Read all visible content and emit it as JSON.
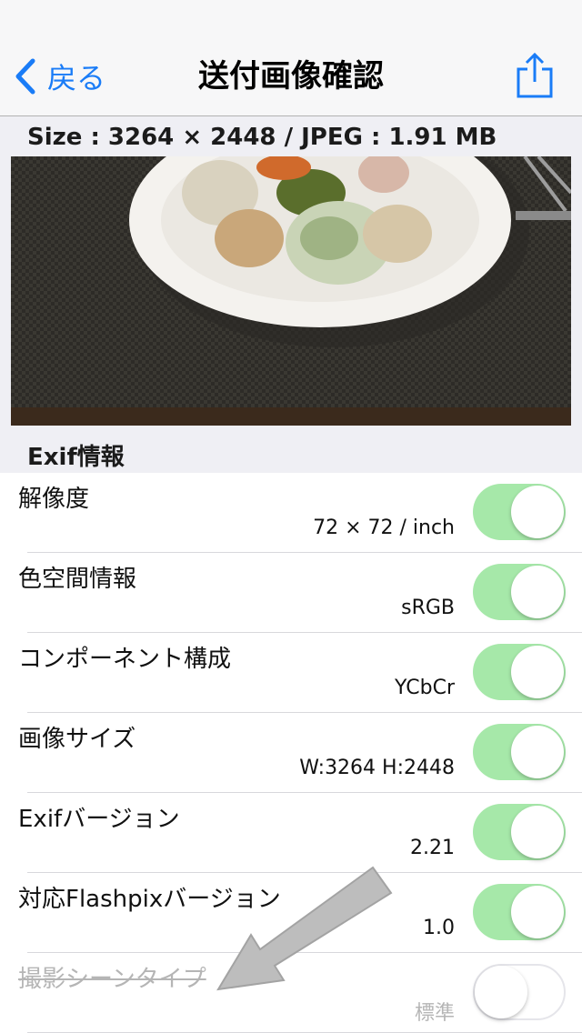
{
  "nav": {
    "back_label": "戻る",
    "title": "送付画像確認"
  },
  "image_info": "Size : 3264 × 2448 / JPEG : 1.91 MB",
  "section_title": "Exif情報",
  "rows": [
    {
      "label": "解像度",
      "value": "72 × 72 / inch",
      "on": true
    },
    {
      "label": "色空間情報",
      "value": "sRGB",
      "on": true
    },
    {
      "label": "コンポーネント構成",
      "value": "YCbCr",
      "on": true
    },
    {
      "label": "画像サイズ",
      "value": "W:3264 H:2448",
      "on": true
    },
    {
      "label": "Exifバージョン",
      "value": "2.21",
      "on": true
    },
    {
      "label": "対応Flashpixバージョン",
      "value": "1.0",
      "on": true
    },
    {
      "label": "撮影シーンタイプ",
      "value": "標準",
      "on": false
    }
  ],
  "colors": {
    "accent": "#1a7cf7",
    "toggle_on": "#a6e8a9",
    "disabled_text": "#b5b5b5"
  },
  "icons": [
    "chevron-left-icon",
    "share-icon",
    "annotation-arrow-icon"
  ]
}
